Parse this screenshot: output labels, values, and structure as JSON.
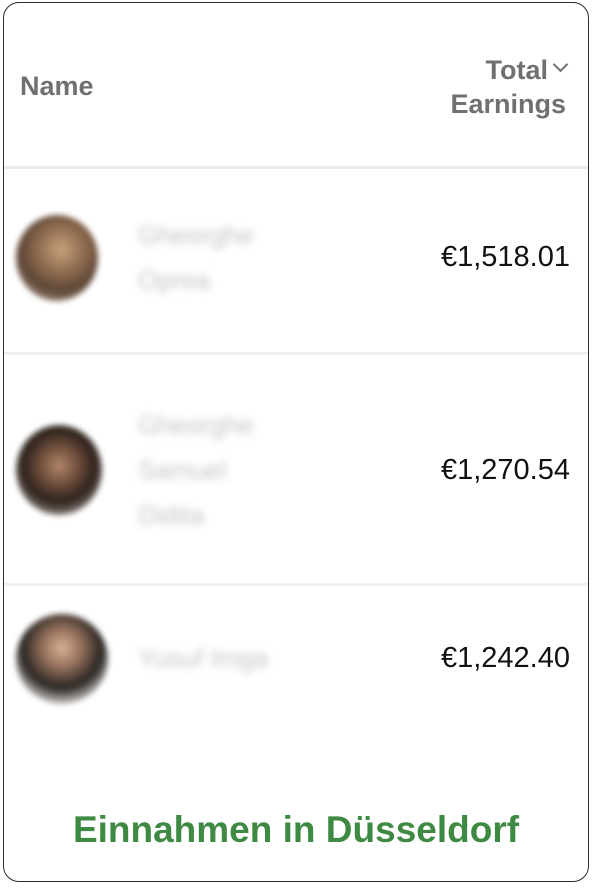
{
  "table": {
    "columns": {
      "name": "Name",
      "total_line1": "Total",
      "total_line2": "Earnings"
    },
    "rows": [
      {
        "name": "Gheorghe Oprea",
        "earnings": "€1,518.01"
      },
      {
        "name": "Gheorghe Samuel Didita",
        "earnings": "€1,270.54"
      },
      {
        "name": "Yusuf Imga",
        "earnings": "€1,242.40"
      }
    ]
  },
  "caption": "Einnahmen in Düsseldorf",
  "colors": {
    "header_text": "#707070",
    "earnings_text": "#111111",
    "caption": "#3f8a43",
    "card_border": "#2b2b2b"
  },
  "icons": {
    "sort": "chevron-down-icon"
  }
}
